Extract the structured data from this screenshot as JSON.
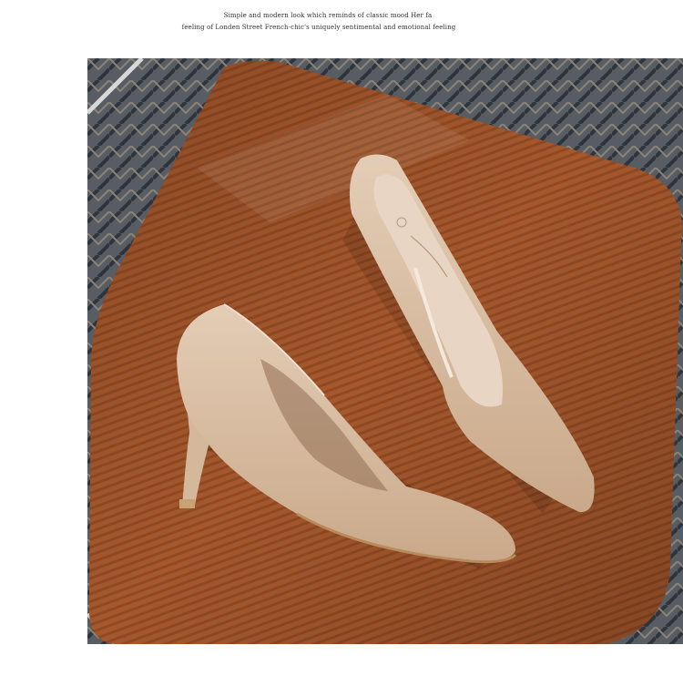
{
  "caption": {
    "line1": "Simple and modern look which reminds of classic mood  Her fa",
    "line2": "feeling of Londen Street French-chic's uniquely sentimental and emotional feeling"
  },
  "photo": {
    "subject": "beige suede pointed-toe stiletto pumps on a rust corduroy cushion",
    "colors": {
      "cushion": "#a85a2e",
      "shoe": "#d9c1a8",
      "background_fabric": "#4a4f58"
    }
  }
}
